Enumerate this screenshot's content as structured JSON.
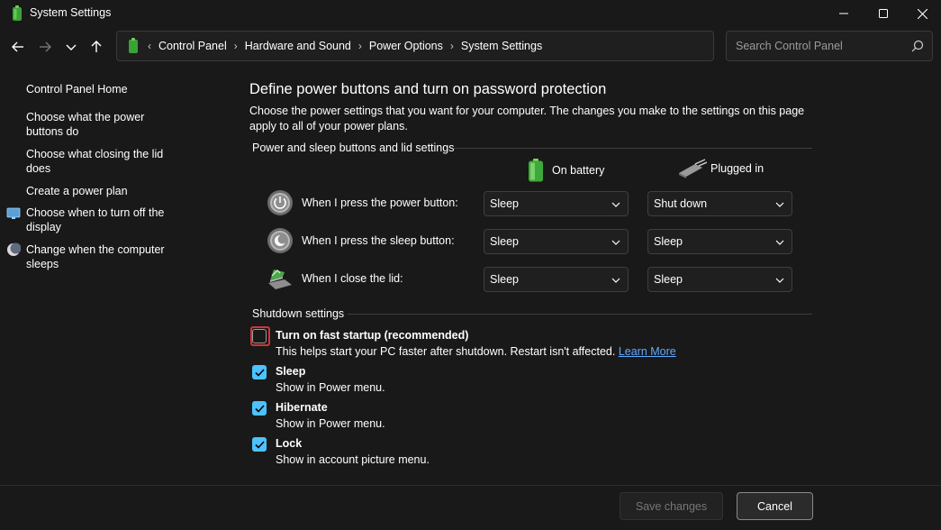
{
  "window": {
    "title": "System Settings",
    "icon": "power-options-icon",
    "controls": [
      "minimize-icon",
      "maximize-icon",
      "close-icon"
    ]
  },
  "nav": {
    "breadcrumb": [
      "Control Panel",
      "Hardware and Sound",
      "Power Options",
      "System Settings"
    ],
    "search_placeholder": "Search Control Panel"
  },
  "sidebar": {
    "items": [
      {
        "label": "Control Panel Home",
        "icon": ""
      },
      {
        "label": "Choose what the power buttons do",
        "icon": ""
      },
      {
        "label": "Choose what closing the lid does",
        "icon": ""
      },
      {
        "label": "Create a power plan",
        "icon": ""
      },
      {
        "label": "Choose when to turn off the display",
        "icon": "monitor-icon"
      },
      {
        "label": "Change when the computer sleeps",
        "icon": "moon-icon"
      }
    ]
  },
  "main": {
    "title": "Define power buttons and turn on password protection",
    "description": "Choose the power settings that you want for your computer. The changes you make to the settings on this page apply to all of your power plans.",
    "section_buttons": "Power and sleep buttons and lid settings",
    "columns": {
      "on_battery": "On battery",
      "plugged_in": "Plugged in"
    },
    "rows": [
      {
        "label": "When I press the power button:",
        "icon": "power-button-icon",
        "on_battery": "Sleep",
        "plugged_in": "Shut down"
      },
      {
        "label": "When I press the sleep button:",
        "icon": "sleep-button-icon",
        "on_battery": "Sleep",
        "plugged_in": "Sleep"
      },
      {
        "label": "When I close the lid:",
        "icon": "laptop-lid-icon",
        "on_battery": "Sleep",
        "plugged_in": "Sleep"
      }
    ],
    "section_shutdown": "Shutdown settings",
    "shutdown_options": [
      {
        "title": "Turn on fast startup (recommended)",
        "desc": "This helps start your PC faster after shutdown. Restart isn't affected.",
        "link": "Learn More",
        "checked": false
      },
      {
        "title": "Sleep",
        "desc": "Show in Power menu.",
        "checked": true
      },
      {
        "title": "Hibernate",
        "desc": "Show in Power menu.",
        "checked": true
      },
      {
        "title": "Lock",
        "desc": "Show in account picture menu.",
        "checked": true
      }
    ]
  },
  "footer": {
    "save_label": "Save changes",
    "cancel_label": "Cancel"
  },
  "colors": {
    "background": "#191919",
    "accent": "#4cc2ff",
    "link": "#60aaff",
    "focus_ring": "#d13438"
  }
}
